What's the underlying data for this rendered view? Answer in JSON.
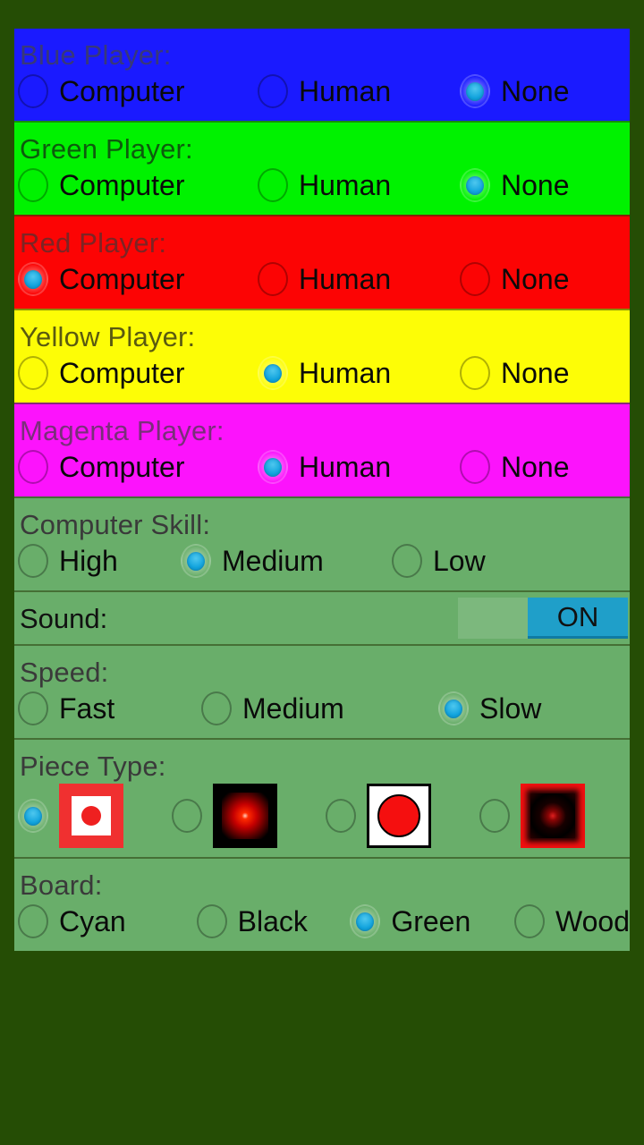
{
  "theme": {
    "background": "#254d05",
    "panel_green": "#69ae6a",
    "accent": "#11a3dd",
    "blue": "#1a1aff",
    "green": "#00f200",
    "red": "#fc0404",
    "yellow": "#fdfd06",
    "magenta": "#fc13fc"
  },
  "groups": {
    "blue_player": {
      "title": "Blue Player:",
      "options": [
        {
          "label": "Computer",
          "selected": false
        },
        {
          "label": "Human",
          "selected": false
        },
        {
          "label": "None",
          "selected": true
        }
      ]
    },
    "green_player": {
      "title": "Green Player:",
      "options": [
        {
          "label": "Computer",
          "selected": false
        },
        {
          "label": "Human",
          "selected": false
        },
        {
          "label": "None",
          "selected": true
        }
      ]
    },
    "red_player": {
      "title": "Red Player:",
      "options": [
        {
          "label": "Computer",
          "selected": true
        },
        {
          "label": "Human",
          "selected": false
        },
        {
          "label": "None",
          "selected": false
        }
      ]
    },
    "yellow_player": {
      "title": "Yellow Player:",
      "options": [
        {
          "label": "Computer",
          "selected": false
        },
        {
          "label": "Human",
          "selected": true
        },
        {
          "label": "None",
          "selected": false
        }
      ]
    },
    "magenta_player": {
      "title": "Magenta Player:",
      "options": [
        {
          "label": "Computer",
          "selected": false
        },
        {
          "label": "Human",
          "selected": true
        },
        {
          "label": "None",
          "selected": false
        }
      ]
    },
    "computer_skill": {
      "title": "Computer Skill:",
      "options": [
        {
          "label": "High",
          "selected": false
        },
        {
          "label": "Medium",
          "selected": true
        },
        {
          "label": "Low",
          "selected": false
        }
      ]
    },
    "sound": {
      "title": "Sound:",
      "switch_label": "ON",
      "switch_state": "on"
    },
    "speed": {
      "title": "Speed:",
      "options": [
        {
          "label": "Fast",
          "selected": false
        },
        {
          "label": "Medium",
          "selected": false
        },
        {
          "label": "Slow",
          "selected": true
        }
      ]
    },
    "piece_type": {
      "title": "Piece Type:",
      "options": [
        {
          "swatch": "red-square-white-inset-dot",
          "selected": true
        },
        {
          "swatch": "black-square-red-glow",
          "selected": false
        },
        {
          "swatch": "white-square-red-circle",
          "selected": false
        },
        {
          "swatch": "red-square-black-bevel",
          "selected": false
        }
      ]
    },
    "board": {
      "title": "Board:",
      "options": [
        {
          "label": "Cyan",
          "selected": false
        },
        {
          "label": "Black",
          "selected": false
        },
        {
          "label": "Green",
          "selected": true
        },
        {
          "label": "Wood",
          "selected": false
        }
      ]
    }
  }
}
